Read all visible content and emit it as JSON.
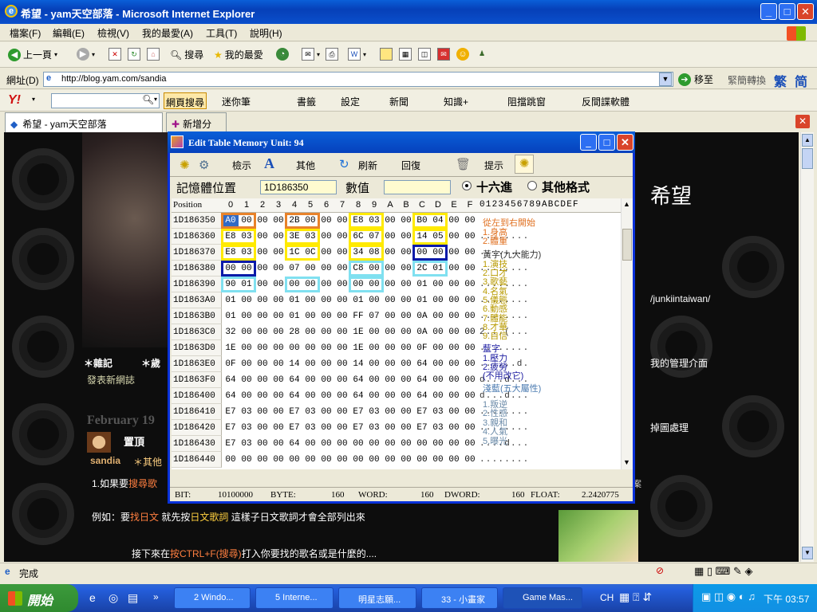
{
  "window": {
    "title": "希望 - yam天空部落 - Microsoft Internet Explorer"
  },
  "menu": [
    "檔案(F)",
    "編輯(E)",
    "檢視(V)",
    "我的最愛(A)",
    "工具(T)",
    "說明(H)"
  ],
  "toolbar": {
    "back": "上一頁",
    "search": "搜尋",
    "favorites": "我的最愛"
  },
  "address": {
    "label": "網址(D)",
    "url": "http://blog.yam.com/sandia",
    "go": "移至",
    "convert": "緊簡轉換",
    "trad": "繁",
    "simp": "简"
  },
  "yahoo": {
    "search_btn": "網頁搜尋",
    "items": [
      "迷你筆",
      "書籤",
      "設定",
      "新聞",
      "知識+",
      "阻擋跳窗",
      "反間諜軟體"
    ]
  },
  "tabs": {
    "current": "希望 - yam天空部落",
    "new": "新增分頁"
  },
  "blog": {
    "title_fragment": "希望",
    "url_fragment": "/junkiintaiwan/",
    "admin": "我的管理介面",
    "img_proc": "掉圖處理",
    "nav1": "＊雜記",
    "nav2": "＊歲",
    "new_post": "發表新網誌",
    "date": "February 19",
    "pin": "置頂",
    "author": "sandia",
    "cat": "＊其他",
    "line1_a": "1.如果要",
    "line1_b": "搜尋歌",
    "line2_a": "例如：要",
    "line2_b": "找日文",
    "line2_c": " 就先按",
    "line2_d": "日文歌詞",
    "line2_e": " 這樣子日文歌詞才會全部列出來",
    "line3_a": "接下來在",
    "line3_b": "按CTRL+F(搜尋)",
    "line3_c": "打入你要找的歌名或是什麼的....",
    "side_char": "案"
  },
  "status": {
    "text": "完成"
  },
  "taskbar": {
    "start": "開始",
    "tasks": [
      "2 Windo...",
      "5 Interne...",
      "明星志願...",
      "33 - 小畫家",
      "Game Mas..."
    ],
    "lang": "CH",
    "time": "下午 03:57"
  },
  "dialog": {
    "title": "Edit Table  Memory Unit: 94",
    "tools": [
      "檢示",
      "其他",
      "刷新",
      "回復",
      "提示"
    ],
    "addr_label": "記憶體位置",
    "addr_value": "1D186350",
    "val_label": "數值",
    "val_value": "",
    "hex_label": "十六進",
    "other_label": "其他格式",
    "col_pos": "Position",
    "cols": [
      "0",
      "1",
      "2",
      "3",
      "4",
      "5",
      "6",
      "7",
      "8",
      "9",
      "A",
      "B",
      "C",
      "D",
      "E",
      "F"
    ],
    "ascii_cols": "0123456789ABCDEF",
    "rows": [
      {
        "addr": "1D186350",
        "bytes": [
          "A0",
          "00",
          "00",
          "00",
          "2B",
          "00",
          "00",
          "00",
          "E8",
          "03",
          "00",
          "00",
          "B0",
          "04",
          "00",
          "00"
        ],
        "ascii": ""
      },
      {
        "addr": "1D186360",
        "bytes": [
          "E8",
          "03",
          "00",
          "00",
          "3E",
          "03",
          "00",
          "00",
          "6C",
          "07",
          "00",
          "00",
          "14",
          "05",
          "00",
          "00"
        ],
        "ascii": "........"
      },
      {
        "addr": "1D186370",
        "bytes": [
          "E8",
          "03",
          "00",
          "00",
          "1C",
          "0C",
          "00",
          "00",
          "34",
          "08",
          "00",
          "00",
          "00",
          "00",
          "00",
          "00"
        ],
        "ascii": "........"
      },
      {
        "addr": "1D186380",
        "bytes": [
          "00",
          "00",
          "00",
          "00",
          "07",
          "00",
          "00",
          "00",
          "C8",
          "00",
          "00",
          "00",
          "2C",
          "01",
          "00",
          "00"
        ],
        "ascii": "....,..."
      },
      {
        "addr": "1D186390",
        "bytes": [
          "90",
          "01",
          "00",
          "00",
          "00",
          "00",
          "00",
          "00",
          "00",
          "00",
          "00",
          "00",
          "01",
          "00",
          "00",
          "00"
        ],
        "ascii": "........"
      },
      {
        "addr": "1D1863A0",
        "bytes": [
          "01",
          "00",
          "00",
          "00",
          "01",
          "00",
          "00",
          "00",
          "01",
          "00",
          "00",
          "00",
          "01",
          "00",
          "00",
          "00"
        ],
        "ascii": "........"
      },
      {
        "addr": "1D1863B0",
        "bytes": [
          "01",
          "00",
          "00",
          "00",
          "01",
          "00",
          "00",
          "00",
          "FF",
          "07",
          "00",
          "00",
          "0A",
          "00",
          "00",
          "00"
        ],
        "ascii": "........"
      },
      {
        "addr": "1D1863C0",
        "bytes": [
          "32",
          "00",
          "00",
          "00",
          "28",
          "00",
          "00",
          "00",
          "1E",
          "00",
          "00",
          "00",
          "0A",
          "00",
          "00",
          "00"
        ],
        "ascii": "2...(..."
      },
      {
        "addr": "1D1863D0",
        "bytes": [
          "1E",
          "00",
          "00",
          "00",
          "00",
          "00",
          "00",
          "00",
          "1E",
          "00",
          "00",
          "00",
          "0F",
          "00",
          "00",
          "00"
        ],
        "ascii": "........"
      },
      {
        "addr": "1D1863E0",
        "bytes": [
          "0F",
          "00",
          "00",
          "00",
          "14",
          "00",
          "00",
          "00",
          "14",
          "00",
          "00",
          "00",
          "64",
          "00",
          "00",
          "00"
        ],
        "ascii": "......d."
      },
      {
        "addr": "1D1863F0",
        "bytes": [
          "64",
          "00",
          "00",
          "00",
          "64",
          "00",
          "00",
          "00",
          "64",
          "00",
          "00",
          "00",
          "64",
          "00",
          "00",
          "00"
        ],
        "ascii": "d...d..."
      },
      {
        "addr": "1D186400",
        "bytes": [
          "64",
          "00",
          "00",
          "00",
          "64",
          "00",
          "00",
          "00",
          "64",
          "00",
          "00",
          "00",
          "64",
          "00",
          "00",
          "00"
        ],
        "ascii": "d...d..."
      },
      {
        "addr": "1D186410",
        "bytes": [
          "E7",
          "03",
          "00",
          "00",
          "E7",
          "03",
          "00",
          "00",
          "E7",
          "03",
          "00",
          "00",
          "E7",
          "03",
          "00",
          "00"
        ],
        "ascii": "........"
      },
      {
        "addr": "1D186420",
        "bytes": [
          "E7",
          "03",
          "00",
          "00",
          "E7",
          "03",
          "00",
          "00",
          "E7",
          "03",
          "00",
          "00",
          "E7",
          "03",
          "00",
          "00"
        ],
        "ascii": "........"
      },
      {
        "addr": "1D186430",
        "bytes": [
          "E7",
          "03",
          "00",
          "00",
          "64",
          "00",
          "00",
          "00",
          "00",
          "00",
          "00",
          "00",
          "00",
          "00",
          "00",
          "00"
        ],
        "ascii": "....d..."
      },
      {
        "addr": "1D186440",
        "bytes": [
          "00",
          "00",
          "00",
          "00",
          "00",
          "00",
          "00",
          "00",
          "00",
          "00",
          "00",
          "00",
          "00",
          "00",
          "00",
          "00"
        ],
        "ascii": "........"
      }
    ],
    "annotations": [
      {
        "text": "從左到右開始",
        "color": "#e07020"
      },
      {
        "text": "1.身高",
        "color": "#e07020"
      },
      {
        "text": "2.體重",
        "color": "#e07020"
      },
      {
        "text": "黃字(九大能力)",
        "color": "#333333"
      },
      {
        "text": "1.演技",
        "color": "#b89a00"
      },
      {
        "text": "2.口才",
        "color": "#b89a00"
      },
      {
        "text": "3.歌藝",
        "color": "#b89a00"
      },
      {
        "text": "4.名氣",
        "color": "#b89a00"
      },
      {
        "text": "5.儀態",
        "color": "#b89a00"
      },
      {
        "text": "6.動感",
        "color": "#b89a00"
      },
      {
        "text": "7.體能",
        "color": "#b89a00"
      },
      {
        "text": "8.才華",
        "color": "#b89a00"
      },
      {
        "text": "9.自信",
        "color": "#b89a00"
      },
      {
        "text": "藍字",
        "color": "#1a1aa0"
      },
      {
        "text": "1.壓力",
        "color": "#1a1aa0"
      },
      {
        "text": "2.疲勞",
        "color": "#1a1aa0"
      },
      {
        "text": "(不用改它)",
        "color": "#1a1aa0"
      },
      {
        "text": "淺藍(五大屬性)",
        "color": "#4a7ab0"
      },
      {
        "text": "1.叛逆",
        "color": "#6a8aa8"
      },
      {
        "text": "2.性感",
        "color": "#6a8aa8"
      },
      {
        "text": "3.親和",
        "color": "#6a8aa8"
      },
      {
        "text": "4.人氣",
        "color": "#6a8aa8"
      },
      {
        "text": "5.曝光",
        "color": "#6a8aa8"
      }
    ],
    "status": {
      "bit_label": "BIT:",
      "bit": "10100000",
      "byte_label": "BYTE:",
      "byte": "160",
      "word_label": "WORD:",
      "word": "160",
      "dword_label": "DWORD:",
      "dword": "160",
      "float_label": "FLOAT:",
      "float": "2.2420775"
    }
  },
  "colors": {
    "orange": "#e8822a",
    "yellow": "#ffea00",
    "blue": "#0a1aa8",
    "cyan": "#80e0f0"
  }
}
